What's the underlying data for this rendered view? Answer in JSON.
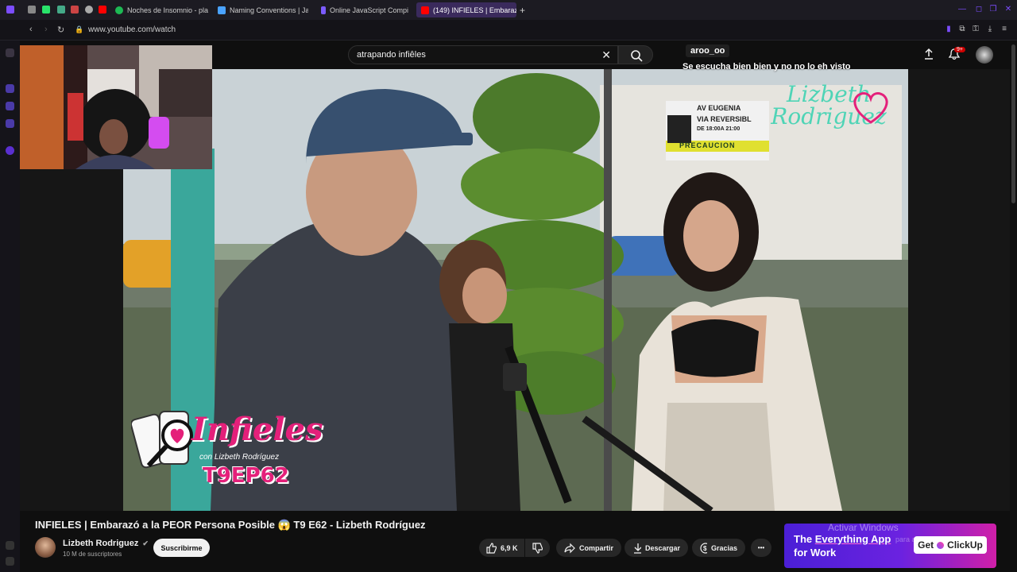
{
  "browser": {
    "tabs": [
      {
        "label": "Noches de Insomnio - pla",
        "icon": "spotify-icon",
        "color": "#1db954"
      },
      {
        "label": "Naming Conventions | Ja",
        "icon": "doc-icon",
        "color": "#4aa3ff"
      },
      {
        "label": "Online JavaScript Compi",
        "icon": "compiler-icon",
        "color": "#7c5cff"
      },
      {
        "label": "(149) INFIELES | Embaraz",
        "icon": "youtube-icon",
        "color": "#ff0000",
        "active": true
      }
    ],
    "new_tab_label": "+",
    "url": "www.youtube.com/watch"
  },
  "youtube": {
    "search": {
      "value": "atrapando infiêles",
      "clear_label": "✕"
    },
    "notifications_badge": "9+"
  },
  "chat": {
    "username": "aroo_oo",
    "message": "Se escucha bien bien y no no lo eh visto"
  },
  "video_overlay": {
    "brand_text": "Lizbeth Rodriguez",
    "show_title": "Infieles",
    "show_subtitle": "con Lizbeth Rodríguez",
    "episode": "T9EP62",
    "sign_line1": "AV EUGENIA",
    "sign_line2": "VIA REVERSIBL",
    "sign_line3": "DE 18:00A 21:00",
    "sign_warning": "PRECAUCION"
  },
  "video": {
    "title": "INFIELES | Embarazó a la PEOR Persona Posible 😱 T9 E62 - Lizbeth Rodríguez",
    "channel": "Lizbeth Rodriguez",
    "verified": "✔",
    "subscribers": "10 M de suscriptores",
    "subscribe_label": "Suscribirme",
    "likes": "6,9 K",
    "share_label": "Compartir",
    "download_label": "Descargar",
    "thanks_label": "Gracias",
    "more_label": "•••"
  },
  "ad": {
    "line1_prefix": "The ",
    "line1_emph": "Everything App",
    "line2": "for Work",
    "cta": "Get",
    "brand": "ClickUp"
  },
  "os_watermark": {
    "line1": "Activar Windows",
    "line2": "para activar Windows."
  },
  "colors": {
    "accent": "#ff0000",
    "chrome": "#1c1b22",
    "background": "#0f0f0f"
  }
}
